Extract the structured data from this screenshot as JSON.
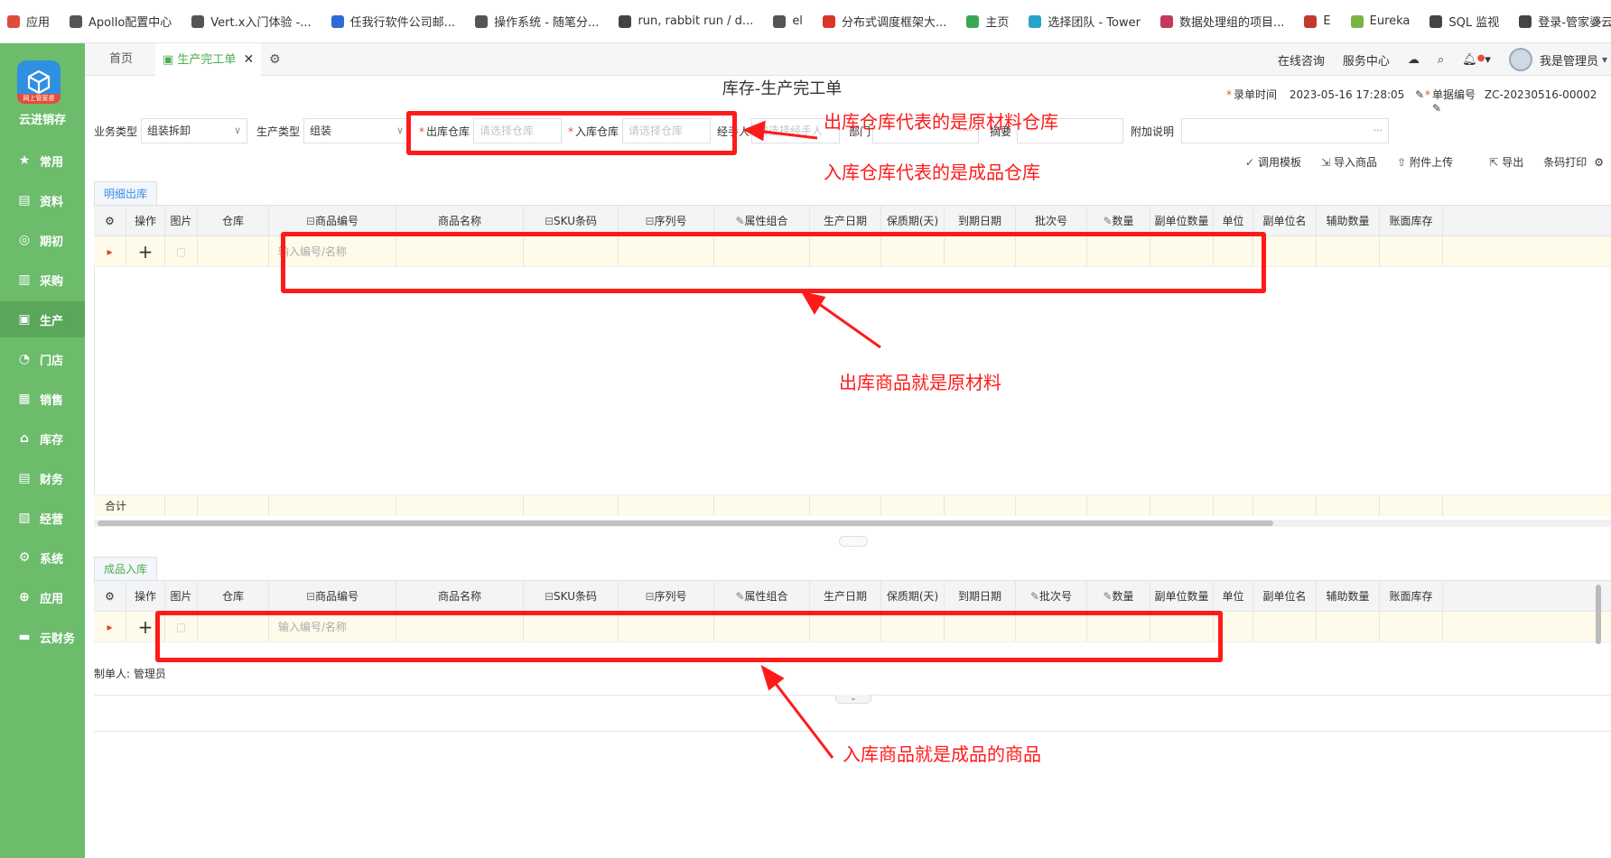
{
  "bookmarks": [
    {
      "label": "应用",
      "color": "#e04a3c"
    },
    {
      "label": "Apollo配置中心",
      "color": "#555555"
    },
    {
      "label": "Vert.x入门体验 -...",
      "color": "#555555"
    },
    {
      "label": "任我行软件公司邮...",
      "color": "#2f6bd8"
    },
    {
      "label": "操作系统 - 随笔分...",
      "color": "#555555"
    },
    {
      "label": "run, rabbit run / d...",
      "color": "#444444"
    },
    {
      "label": "el",
      "color": "#555555"
    },
    {
      "label": "分布式调度框架大...",
      "color": "#d9362b"
    },
    {
      "label": "主页",
      "color": "#3aa757"
    },
    {
      "label": "选择团队 - Tower",
      "color": "#26a3c9"
    },
    {
      "label": "数据处理组的项目...",
      "color": "#c7385f"
    },
    {
      "label": "E",
      "color": "#c0392b"
    },
    {
      "label": "Eureka",
      "color": "#7cb342"
    },
    {
      "label": "SQL 监视",
      "color": "#444444"
    },
    {
      "label": "登录-管家婆云ERP...",
      "color": "#444444"
    }
  ],
  "sidebar": {
    "logo_tag": "网上管家婆",
    "brand": "云进销存",
    "items": [
      {
        "label": "常用",
        "icon": "star-icon",
        "glyph": "★"
      },
      {
        "label": "资料",
        "icon": "document-icon",
        "glyph": "▤"
      },
      {
        "label": "期初",
        "icon": "target-icon",
        "glyph": "◎"
      },
      {
        "label": "采购",
        "icon": "purchase-icon",
        "glyph": "▥"
      },
      {
        "label": "生产",
        "icon": "production-icon",
        "glyph": "▣"
      },
      {
        "label": "门店",
        "icon": "store-icon",
        "glyph": "◔"
      },
      {
        "label": "销售",
        "icon": "sales-icon",
        "glyph": "▦"
      },
      {
        "label": "库存",
        "icon": "warehouse-icon",
        "glyph": "⌂"
      },
      {
        "label": "财务",
        "icon": "finance-icon",
        "glyph": "▤"
      },
      {
        "label": "经营",
        "icon": "business-icon",
        "glyph": "▧"
      },
      {
        "label": "系统",
        "icon": "system-icon",
        "glyph": "⚙"
      },
      {
        "label": "应用",
        "icon": "apps-icon",
        "glyph": "⊕"
      },
      {
        "label": "云财务",
        "icon": "cloud-finance-icon",
        "glyph": "▬"
      }
    ],
    "active_index": 4
  },
  "tabs": {
    "home": "首页",
    "current": "生产完工单",
    "close": "✕"
  },
  "topbar": {
    "online_consult": "在线咨询",
    "service_center": "服务中心",
    "user": "我是管理员"
  },
  "page": {
    "title": "库存-生产完工单",
    "entry_time_label": "录单时间",
    "entry_time": "2023-05-16 17:28:05",
    "doc_no_label": "单据编号",
    "doc_no": "ZC-20230516-00002"
  },
  "form": {
    "biz_type_label": "业务类型",
    "biz_type_value": "组装拆卸",
    "prod_type_label": "生产类型",
    "prod_type_value": "组装",
    "out_wh_label": "出库仓库",
    "out_wh_placeholder": "请选择仓库",
    "in_wh_label": "入库仓库",
    "in_wh_placeholder": "请选择仓库",
    "handler_label": "经手人",
    "handler_placeholder": "请选择经手人",
    "dept_label": "部门",
    "summary_label": "摘要",
    "extra_label": "附加说明",
    "ellipsis": "···"
  },
  "toolbar": {
    "template": "调用模板",
    "import": "导入商品",
    "attach": "附件上传",
    "export": "导出",
    "barcode": "条码打印"
  },
  "out_section": {
    "tag": "明细出库",
    "row_placeholder": "输入编号/名称",
    "total_label": "合计"
  },
  "in_section": {
    "tag": "成品入库",
    "row_placeholder": "输入编号/名称"
  },
  "columns": [
    "操作",
    "图片",
    "仓库",
    "商品编号",
    "商品名称",
    "SKU条码",
    "序列号",
    "属性组合",
    "生产日期",
    "保质期(天)",
    "到期日期",
    "批次号",
    "数量",
    "副单位数量",
    "单位",
    "副单位名",
    "辅助数量",
    "账面库存"
  ],
  "maker": {
    "label": "制单人:",
    "name": "管理员"
  },
  "annotations": {
    "note_warehouse_out": "出库仓库代表的是原材料仓库",
    "note_warehouse_in": "入库仓库代表的是成品仓库",
    "note_out_goods": "出库商品就是原材料",
    "note_in_goods": "入库商品就是成品的商品",
    "color": "#ff1a1a"
  }
}
